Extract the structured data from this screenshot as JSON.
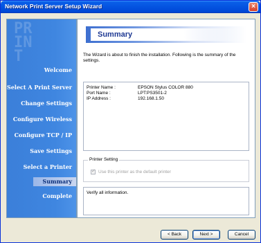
{
  "window": {
    "title": "Network Print Server Setup Wizard",
    "close_glyph": "×"
  },
  "sidebar": {
    "watermark": "PRINT",
    "items": [
      {
        "label": "Welcome",
        "active": false
      },
      {
        "label": "Select A Print Server",
        "active": false
      },
      {
        "label": "Change Settings",
        "active": false
      },
      {
        "label": "Configure Wireless",
        "active": false
      },
      {
        "label": "Configure TCP / IP",
        "active": false
      },
      {
        "label": "Save Settings",
        "active": false
      },
      {
        "label": "Select a Printer",
        "active": false
      },
      {
        "label": "Summary",
        "active": true
      },
      {
        "label": "Complete",
        "active": false
      }
    ]
  },
  "main": {
    "heading": "Summary",
    "intro": "The Wizard is about to finish the installation. Following is the summary of the settings.",
    "summary": [
      {
        "label": "Printer Name :",
        "value": "EPSON Stylus COLOR 880"
      },
      {
        "label": "Port Name :",
        "value": "LPT:PS3501-2"
      },
      {
        "label": "IP Address :",
        "value": "192.168.1.50"
      }
    ],
    "printer_setting": {
      "title": "Printer Setting",
      "checkbox_label": "Use this printer as the default printer",
      "checked": true,
      "check_glyph": "✓"
    },
    "status": "Verify all information."
  },
  "buttons": {
    "back": "< Back",
    "next": "Next >",
    "cancel": "Cancel"
  },
  "colors": {
    "title_bar": "#0453e0",
    "sidebar": "#3f86e0",
    "heading_text": "#1f3a93",
    "close_button": "#d6402a"
  }
}
